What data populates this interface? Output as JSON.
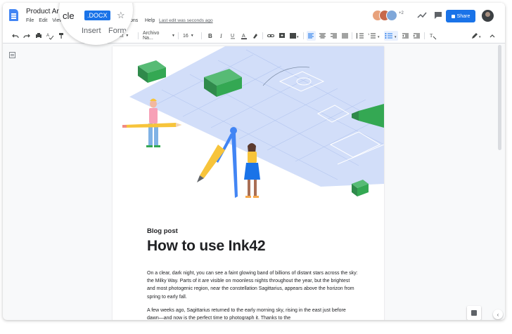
{
  "app": {
    "title": "Product Artic",
    "last_edit": "Last edit was seconds ago",
    "menu": [
      "File",
      "Edit",
      "View"
    ],
    "menu_extra": [
      "ons",
      "Help"
    ],
    "share_label": "Share",
    "avatar_count": "+2"
  },
  "lens": {
    "title": "cle",
    "badge": ".DOCX",
    "menu_insert": "Insert",
    "menu_format": "Form"
  },
  "toolbar": {
    "style_fragment": "ext",
    "font": "Archivo Na...",
    "font_size": "16"
  },
  "doc": {
    "kicker": "Blog post",
    "heading": "How to use Ink42",
    "para1": "On a clear, dark night, you can see a faint glowing band of billions of distant stars across the sky: the Milky Way. Parts of it are visible on moonless nights throughout the year, but the brightest and most photogenic region, near the constellation Sagittarius, appears above the horizon from spring to early fall.",
    "para2": "A few weeks ago, Sagittarius returned to the early morning sky, rising in the east just before dawn—and now is the perfect time to photograph it. Thanks to the"
  },
  "colors": {
    "accent": "#1a73e8",
    "docs_blue": "#4285f4",
    "lego_green": "#34a853",
    "plan_blue": "#c9d7f7"
  },
  "icons": [
    "undo-icon",
    "redo-icon",
    "print-icon",
    "spellcheck-icon",
    "paint-format-icon",
    "bold-icon",
    "italic-icon",
    "underline-icon",
    "text-color-icon",
    "highlight-icon",
    "link-icon",
    "comment-add-icon",
    "image-icon",
    "align-left-icon",
    "align-center-icon",
    "align-right-icon",
    "justify-icon",
    "line-spacing-icon",
    "numbered-list-icon",
    "bulleted-list-icon",
    "indent-less-icon",
    "indent-more-icon",
    "clear-format-icon",
    "edit-mode-icon",
    "chevron-up-icon"
  ]
}
